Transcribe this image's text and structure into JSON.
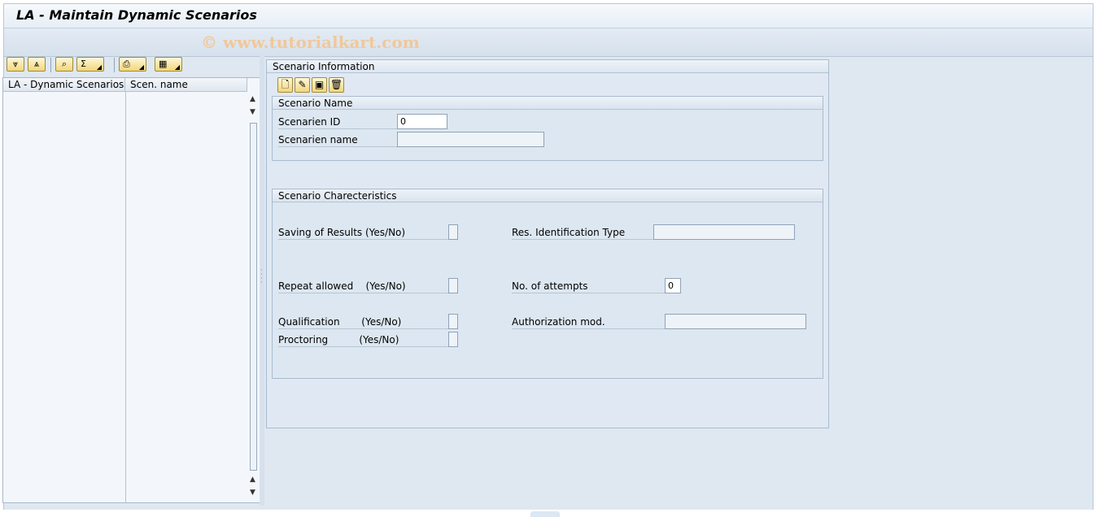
{
  "window": {
    "title": "LA - Maintain Dynamic Scenarios"
  },
  "watermark": "© www.tutorialkart.com",
  "tree_toolbar": {
    "buttons": [
      {
        "name": "expand-all-icon",
        "glyph": "⩔"
      },
      {
        "name": "collapse-all-icon",
        "glyph": "⩓"
      },
      {
        "name": "find-icon",
        "glyph": "⌕"
      },
      {
        "name": "sum-icon",
        "glyph": "Σ"
      },
      {
        "name": "print-icon",
        "glyph": "⎙"
      },
      {
        "name": "layout-grid-icon",
        "glyph": "▦"
      }
    ]
  },
  "tree": {
    "columns": [
      "LA - Dynamic Scenarios",
      "Scen. name"
    ],
    "rows": []
  },
  "scenario_info": {
    "title": "Scenario Information",
    "toolbar": [
      {
        "name": "create-icon",
        "glyph": "🗋"
      },
      {
        "name": "edit-pencil-icon",
        "glyph": "✎"
      },
      {
        "name": "save-icon",
        "glyph": "💾"
      },
      {
        "name": "delete-icon",
        "glyph": "🗑"
      }
    ],
    "scenario_name": {
      "title": "Scenario Name",
      "id_label": "Scenarien ID",
      "id_value": "0",
      "name_label": "Scenarien name",
      "name_value": ""
    },
    "characteristics": {
      "title": "Scenario Charecteristics",
      "saving_label": "Saving of Results (Yes/No)",
      "saving_value": "",
      "res_id_label": "Res. Identification Type",
      "res_id_value": "",
      "repeat_label": "Repeat allowed    (Yes/No)",
      "repeat_value": "",
      "attempts_label": "No. of attempts",
      "attempts_value": "0",
      "qualification_label": "Qualification       (Yes/No)",
      "qualification_value": "",
      "auth_label": "Authorization mod.",
      "auth_value": "",
      "proctoring_label": "Proctoring          (Yes/No)",
      "proctoring_value": ""
    }
  }
}
